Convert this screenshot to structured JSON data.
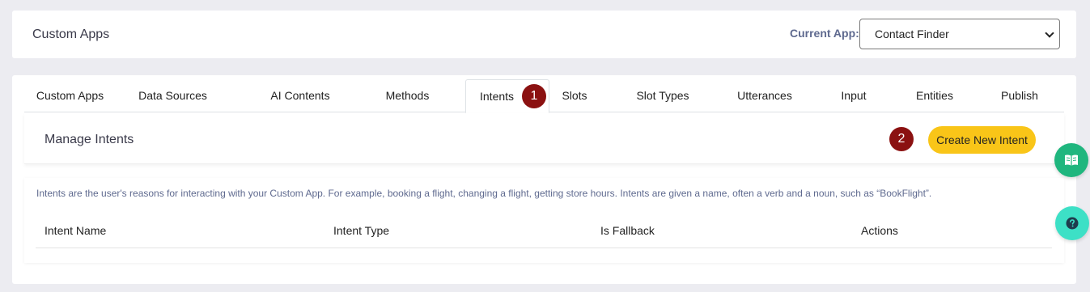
{
  "header": {
    "title": "Custom Apps",
    "current_app_label": "Current App:",
    "current_app_value": "Contact Finder"
  },
  "tabs": [
    {
      "label": "Custom Apps",
      "active": false
    },
    {
      "label": "Data Sources",
      "active": false
    },
    {
      "label": "AI Contents",
      "active": false
    },
    {
      "label": "Methods",
      "active": false
    },
    {
      "label": "Intents",
      "active": true
    },
    {
      "label": "Slots",
      "active": false
    },
    {
      "label": "Slot Types",
      "active": false
    },
    {
      "label": "Utterances",
      "active": false
    },
    {
      "label": "Input",
      "active": false
    },
    {
      "label": "Entities",
      "active": false
    },
    {
      "label": "Publish",
      "active": false
    }
  ],
  "markers": {
    "one": "1",
    "two": "2"
  },
  "manage": {
    "title": "Manage Intents",
    "create_label": "Create New Intent"
  },
  "content": {
    "description": "Intents are the user's reasons for interacting with your Custom App. For example, booking a flight, changing a flight, getting store hours. Intents are given a name, often a verb and a noun, such as “BookFlight”.",
    "columns": [
      "Intent Name",
      "Intent Type",
      "Is Fallback",
      "Actions"
    ]
  },
  "floating": {
    "book_icon": "book-open-icon",
    "help_icon": "question-circle-icon"
  },
  "colors": {
    "badge": "#8b1111",
    "create_button": "#f9c518",
    "book_button": "#1fb67e",
    "help_button": "#3de0c6"
  }
}
